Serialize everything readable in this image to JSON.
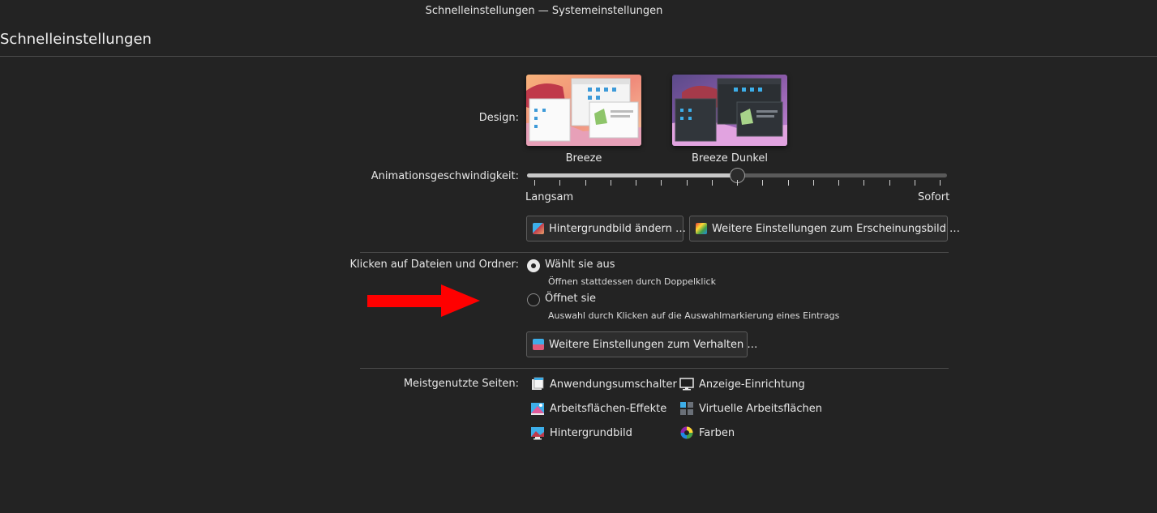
{
  "window": {
    "title": "Schnelleinstellungen — Systemeinstellungen"
  },
  "page": {
    "title": "Schnelleinstellungen"
  },
  "design": {
    "label": "Design:",
    "themes": [
      {
        "name": "Breeze",
        "selected": true
      },
      {
        "name": "Breeze Dunkel",
        "selected": false
      }
    ]
  },
  "animation": {
    "label": "Animationsgeschwindigkeit:",
    "min_label": "Langsam",
    "max_label": "Sofort",
    "value_fraction": 0.5
  },
  "appearance_buttons": {
    "wallpaper": "Hintergrundbild ändern …",
    "more_appearance": "Weitere Einstellungen zum Erscheinungsbild …"
  },
  "click_behavior": {
    "label": "Klicken auf Dateien und Ordner:",
    "options": [
      {
        "label": "Wählt sie aus",
        "description": "Öffnen stattdessen durch Doppelklick",
        "checked": true
      },
      {
        "label": "Öffnet sie",
        "description": "Auswahl durch Klicken auf die Auswahlmarkierung eines Eintrags",
        "checked": false
      }
    ],
    "more_button": "Weitere Einstellungen zum Verhalten …"
  },
  "frequent": {
    "label": "Meistgenutzte Seiten:",
    "items": [
      {
        "label": "Anwendungsumschalter",
        "icon": "task-switcher-icon"
      },
      {
        "label": "Anzeige-Einrichtung",
        "icon": "monitor-icon"
      },
      {
        "label": "Arbeitsflächen-Effekte",
        "icon": "desktop-effects-icon"
      },
      {
        "label": "Virtuelle Arbeitsflächen",
        "icon": "virtual-desktops-icon"
      },
      {
        "label": "Hintergrundbild",
        "icon": "wallpaper-icon"
      },
      {
        "label": "Farben",
        "icon": "colors-icon"
      }
    ]
  },
  "colors": {
    "background": "#232323",
    "annotation_arrow": "#ff0000"
  }
}
